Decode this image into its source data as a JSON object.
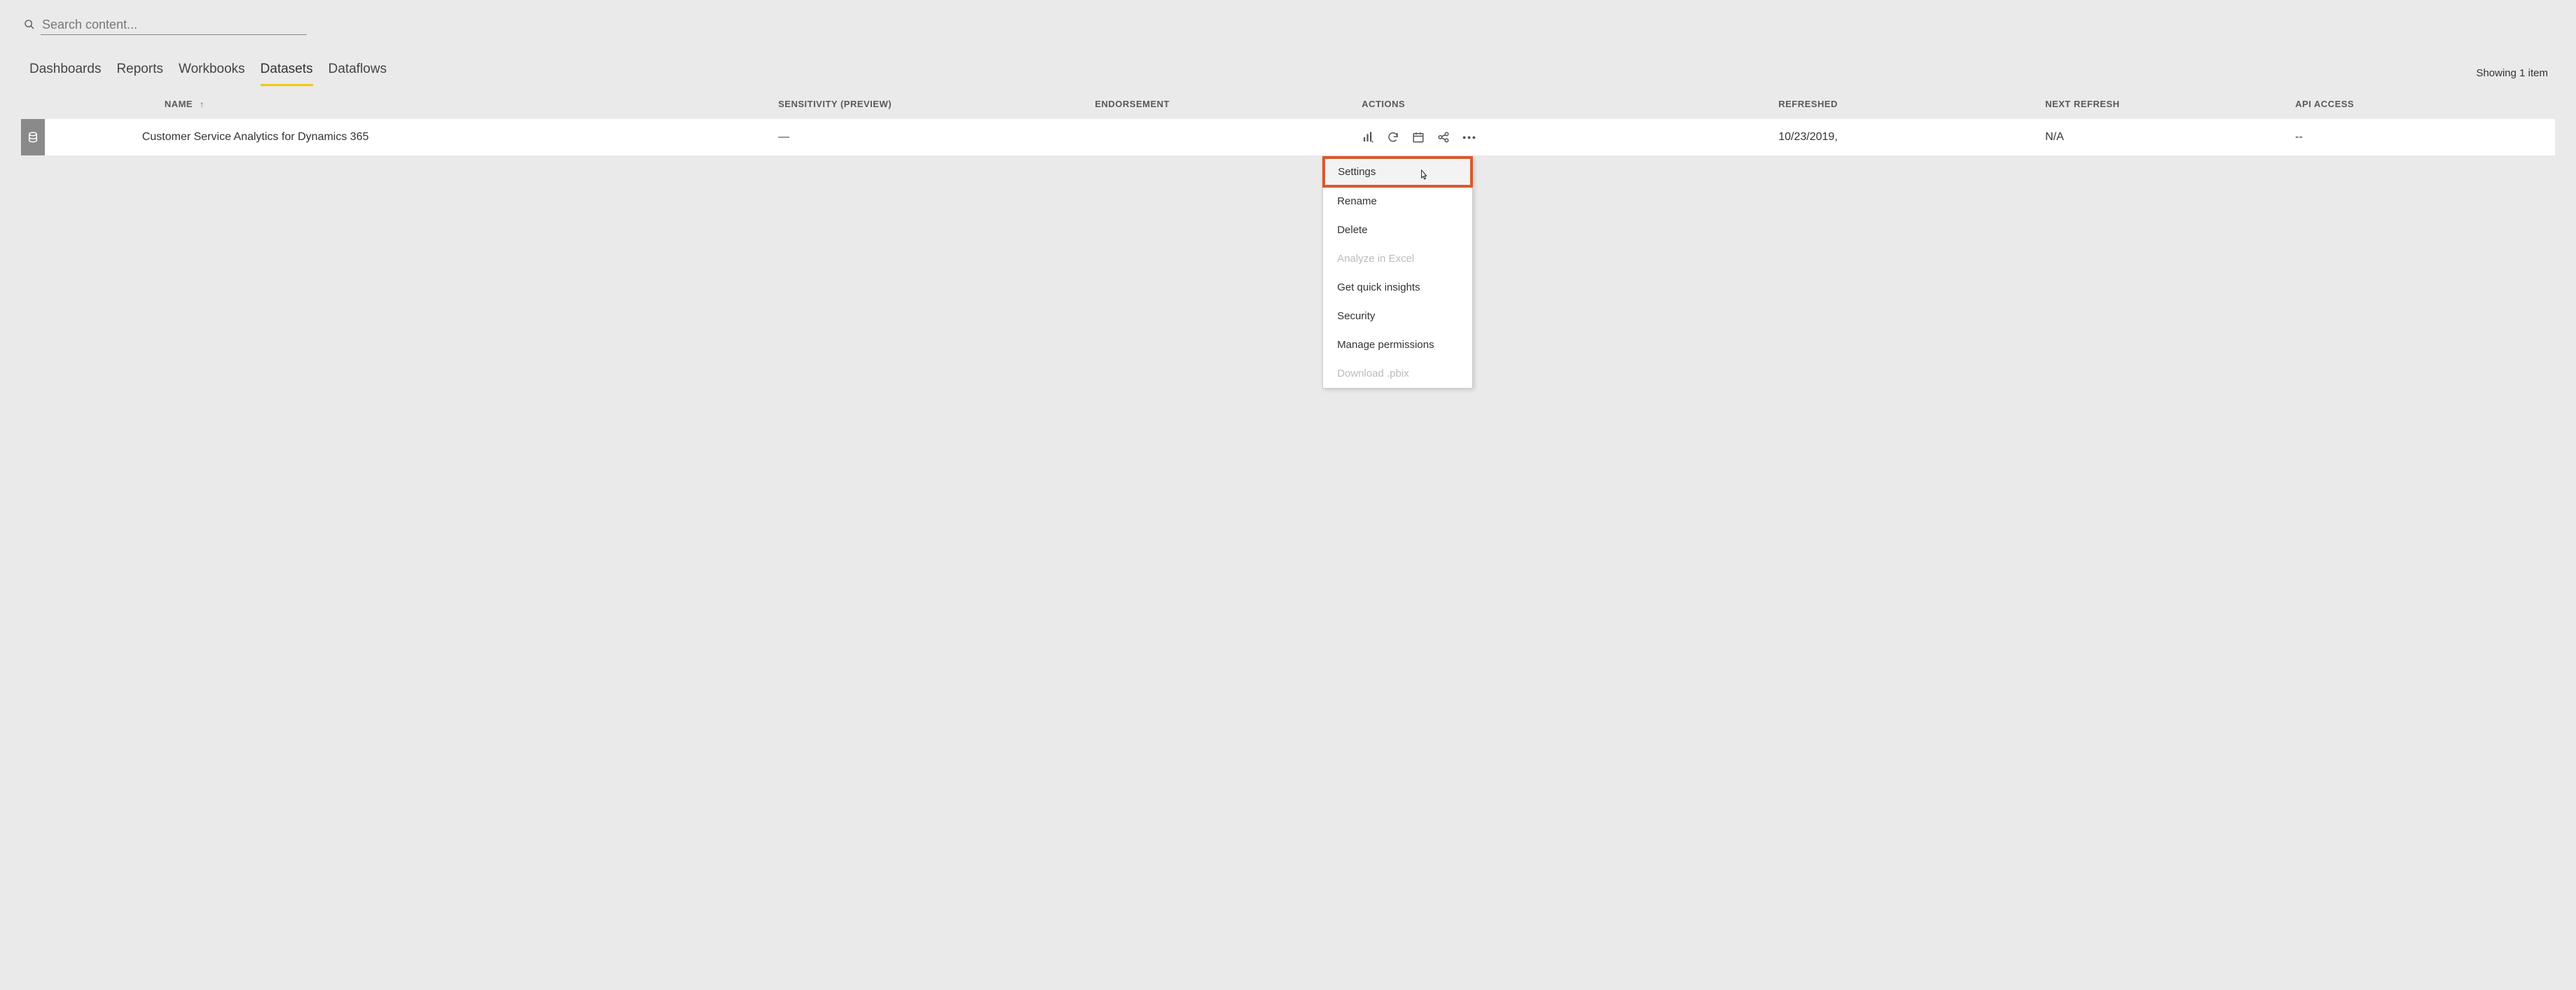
{
  "search": {
    "placeholder": "Search content..."
  },
  "tabs": {
    "items": [
      {
        "label": "Dashboards"
      },
      {
        "label": "Reports"
      },
      {
        "label": "Workbooks"
      },
      {
        "label": "Datasets"
      },
      {
        "label": "Dataflows"
      }
    ],
    "active_index": 3
  },
  "item_count": "Showing 1 item",
  "columns": {
    "name": "NAME",
    "sensitivity": "SENSITIVITY (preview)",
    "endorsement": "ENDORSEMENT",
    "actions": "ACTIONS",
    "refreshed": "REFRESHED",
    "next_refresh": "NEXT REFRESH",
    "api_access": "API ACCESS",
    "sort_arrow": "↑"
  },
  "rows": [
    {
      "name": "Customer Service Analytics for Dynamics 365",
      "sensitivity": "—",
      "endorsement": "",
      "refreshed": "10/23/2019,",
      "next_refresh": "N/A",
      "api_access": "--"
    }
  ],
  "dropdown": {
    "items": [
      {
        "label": "Settings",
        "disabled": false,
        "highlighted": true
      },
      {
        "label": "Rename",
        "disabled": false
      },
      {
        "label": "Delete",
        "disabled": false
      },
      {
        "label": "Analyze in Excel",
        "disabled": true
      },
      {
        "label": "Get quick insights",
        "disabled": false
      },
      {
        "label": "Security",
        "disabled": false
      },
      {
        "label": "Manage permissions",
        "disabled": false
      },
      {
        "label": "Download .pbix",
        "disabled": true
      }
    ]
  }
}
